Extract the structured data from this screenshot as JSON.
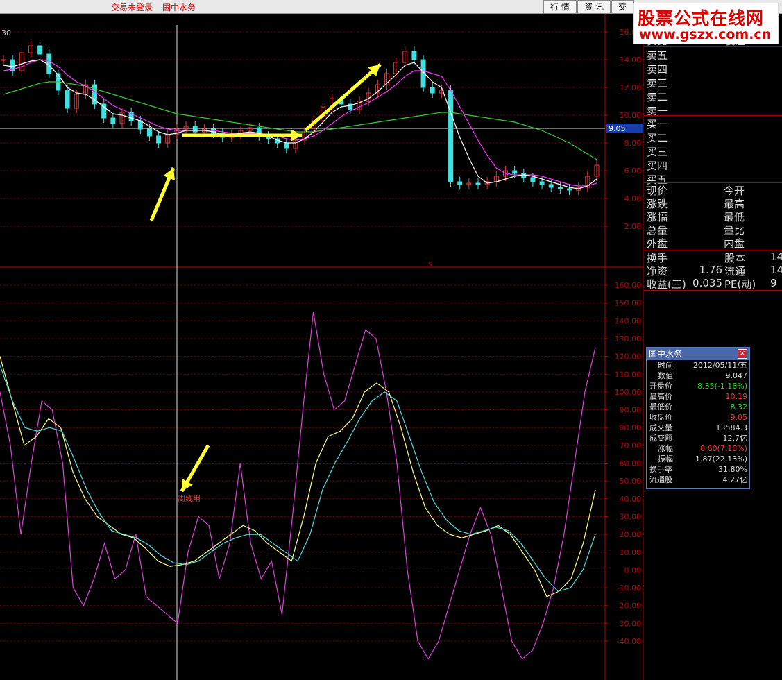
{
  "topbar": {
    "login_status": "交易未登录",
    "stock_name": "国中水务",
    "tabs": [
      "行 情",
      "资 讯",
      "交"
    ]
  },
  "logo": {
    "line1": "股票公式在线网",
    "line2": "www.gszx.com.cn"
  },
  "period_label": "30",
  "price_axis": {
    "ticks": [
      "16.00",
      "14.00",
      "12.00",
      "10.00",
      "8.00",
      "6.00",
      "4.00",
      "2.00"
    ],
    "current_price": "9.05"
  },
  "indicator_axis": {
    "ticks": [
      "160.00",
      "150.00",
      "140.00",
      "130.00",
      "120.00",
      "110.00",
      "100.00",
      "90.00",
      "80.00",
      "70.00",
      "60.00",
      "50.00",
      "40.00",
      "30.00",
      "20.00",
      "10.00",
      "0.00",
      "-10.00",
      "-20.00",
      "-30.00",
      "-40.00"
    ]
  },
  "annotation": {
    "label": "周线用"
  },
  "marker": {
    "label": "$"
  },
  "quote_panel": {
    "sell_header": [
      "卖比",
      "委差"
    ],
    "sell": [
      "卖五",
      "卖四",
      "卖三",
      "卖二",
      "卖一"
    ],
    "buy": [
      "买一",
      "买二",
      "买三",
      "买四",
      "买五"
    ],
    "stats_left": [
      "现价",
      "涨跌",
      "涨幅",
      "总量",
      "外盘"
    ],
    "stats_right": [
      "今开",
      "最高",
      "最低",
      "量比",
      "内盘"
    ],
    "extra": [
      {
        "k1": "换手",
        "v1": "",
        "k2": "股本",
        "v2": "14"
      },
      {
        "k1": "净资",
        "v1": "1.76",
        "k2": "流通",
        "v2": "14"
      },
      {
        "k1": "收益(三)",
        "v1": "0.035",
        "k2": "PE(动)",
        "v2": "9"
      }
    ]
  },
  "info_box": {
    "title": "国中水务",
    "close_label": "×",
    "rows": [
      {
        "k": "时间",
        "v": "2012/05/11/五",
        "c": "#dddddd"
      },
      {
        "k": "数值",
        "v": "9.047",
        "c": "#dddddd"
      },
      {
        "k": "开盘价",
        "v": "8.35(-1.18%)",
        "c": "#22dd22"
      },
      {
        "k": "最高价",
        "v": "10.19",
        "c": "#ff3333"
      },
      {
        "k": "最低价",
        "v": "8.32",
        "c": "#22dd22"
      },
      {
        "k": "收盘价",
        "v": "9.05",
        "c": "#ff3333"
      },
      {
        "k": "成交量",
        "v": "13584.3",
        "c": "#dddddd"
      },
      {
        "k": "成交额",
        "v": "12.7亿",
        "c": "#dddddd"
      },
      {
        "k": "涨幅",
        "v": "0.60(7.10%)",
        "c": "#ff3333"
      },
      {
        "k": "振幅",
        "v": "1.87(22.13%)",
        "c": "#dddddd"
      },
      {
        "k": "换手率",
        "v": "31.80%",
        "c": "#dddddd"
      },
      {
        "k": "流通股",
        "v": "4.27亿",
        "c": "#dddddd"
      }
    ]
  },
  "colors": {
    "grid": "#7a0000",
    "axis": "#c00000",
    "up": "#e23b3b",
    "down": "#40e0e0",
    "ma_white": "#ffffff",
    "ma_magenta": "#ff33ff",
    "ma_green": "#33cc33",
    "ind_magenta": "#dd44dd",
    "ind_yellow": "#ffff88",
    "ind_cyan": "#55dddd",
    "arrow": "#ffff33"
  },
  "chart_data": {
    "type": "line",
    "price_ylim": [
      0,
      17
    ],
    "indicator_ylim": [
      -50,
      170
    ],
    "price_close": [
      14.0,
      13.2,
      14.5,
      15.0,
      14.4,
      13.0,
      11.8,
      10.5,
      11.5,
      12.2,
      10.8,
      9.8,
      9.4,
      10.2,
      9.6,
      9.0,
      8.5,
      8.0,
      8.6,
      9.0,
      9.2,
      8.8,
      9.0,
      8.7,
      8.4,
      8.6,
      8.9,
      9.1,
      8.5,
      8.3,
      8.0,
      7.6,
      8.2,
      8.8,
      9.6,
      10.6,
      11.2,
      10.8,
      10.4,
      11.0,
      11.6,
      12.2,
      13.0,
      13.8,
      14.6,
      14.0,
      12.0,
      11.6,
      11.8,
      5.2,
      5.0,
      5.1,
      5.0,
      5.2,
      5.6,
      6.0,
      5.8,
      5.5,
      5.2,
      5.0,
      4.8,
      4.7,
      4.6,
      4.8,
      5.6,
      6.4
    ],
    "price_ma_white": [
      13.6,
      13.5,
      13.7,
      13.9,
      14.0,
      13.6,
      12.9,
      12.0,
      11.6,
      11.5,
      11.1,
      10.6,
      10.1,
      10.0,
      9.8,
      9.6,
      9.2,
      8.8,
      8.6,
      8.7,
      8.9,
      8.9,
      8.9,
      8.8,
      8.6,
      8.6,
      8.7,
      8.8,
      8.7,
      8.5,
      8.2,
      8.0,
      8.0,
      8.3,
      8.8,
      9.5,
      10.2,
      10.6,
      10.7,
      10.9,
      11.2,
      11.7,
      12.3,
      12.9,
      13.6,
      13.8,
      13.1,
      12.4,
      12.0,
      10.2,
      8.4,
      6.9,
      5.6,
      5.1,
      5.2,
      5.4,
      5.6,
      5.7,
      5.6,
      5.4,
      5.2,
      5.0,
      4.8,
      4.7,
      4.9,
      5.4
    ],
    "price_ma_magenta": [
      13.2,
      13.3,
      13.5,
      13.8,
      14.0,
      13.9,
      13.5,
      12.9,
      12.4,
      12.1,
      11.7,
      11.2,
      10.7,
      10.4,
      10.1,
      9.8,
      9.5,
      9.2,
      9.0,
      8.9,
      8.9,
      8.9,
      8.9,
      8.9,
      8.8,
      8.7,
      8.7,
      8.7,
      8.7,
      8.6,
      8.5,
      8.3,
      8.2,
      8.3,
      8.5,
      8.9,
      9.4,
      9.9,
      10.3,
      10.6,
      10.9,
      11.3,
      11.7,
      12.2,
      12.8,
      13.2,
      13.2,
      13.0,
      12.8,
      11.8,
      10.6,
      9.4,
      8.2,
      7.1,
      6.2,
      5.8,
      5.7,
      5.7,
      5.7,
      5.6,
      5.4,
      5.2,
      5.0,
      4.9,
      4.9,
      5.1
    ],
    "price_ma_green": [
      11.5,
      11.7,
      11.9,
      12.1,
      12.3,
      12.4,
      12.4,
      12.3,
      12.2,
      12.1,
      11.9,
      11.7,
      11.5,
      11.3,
      11.1,
      10.9,
      10.7,
      10.5,
      10.3,
      10.1,
      10.0,
      9.9,
      9.8,
      9.7,
      9.6,
      9.5,
      9.4,
      9.3,
      9.2,
      9.1,
      9.0,
      8.9,
      8.8,
      8.8,
      8.8,
      8.9,
      9.0,
      9.1,
      9.2,
      9.3,
      9.4,
      9.5,
      9.6,
      9.7,
      9.8,
      9.9,
      10.0,
      10.1,
      10.2,
      10.2,
      10.1,
      10.0,
      9.9,
      9.8,
      9.7,
      9.6,
      9.5,
      9.3,
      9.1,
      8.9,
      8.6,
      8.3,
      8.0,
      7.6,
      7.2,
      6.8
    ],
    "ind_magenta": [
      100,
      70,
      20,
      60,
      95,
      90,
      60,
      -10,
      -20,
      -5,
      15,
      -5,
      0,
      20,
      -15,
      -20,
      -25,
      -30,
      10,
      30,
      25,
      -5,
      15,
      60,
      15,
      -5,
      5,
      -25,
      30,
      90,
      145,
      110,
      90,
      95,
      115,
      135,
      130,
      100,
      60,
      0,
      -40,
      -50,
      -40,
      -20,
      0,
      20,
      35,
      20,
      -10,
      -40,
      -50,
      -45,
      -30,
      -10,
      20,
      60,
      100,
      125
    ],
    "ind_yellow": [
      120,
      95,
      70,
      75,
      85,
      80,
      55,
      40,
      30,
      25,
      20,
      18,
      12,
      5,
      2,
      3,
      5,
      10,
      15,
      20,
      25,
      22,
      15,
      10,
      5,
      30,
      60,
      75,
      78,
      85,
      100,
      105,
      100,
      80,
      55,
      35,
      25,
      20,
      18,
      20,
      22,
      25,
      20,
      10,
      0,
      -15,
      -12,
      -5,
      15,
      45
    ],
    "ind_cyan": [
      115,
      95,
      80,
      78,
      80,
      78,
      62,
      45,
      32,
      22,
      20,
      18,
      14,
      8,
      4,
      3,
      5,
      10,
      15,
      18,
      20,
      20,
      15,
      10,
      5,
      20,
      45,
      60,
      72,
      85,
      95,
      100,
      95,
      75,
      55,
      38,
      28,
      22,
      20,
      22,
      24,
      22,
      15,
      5,
      -5,
      -12,
      -10,
      0,
      20
    ]
  }
}
